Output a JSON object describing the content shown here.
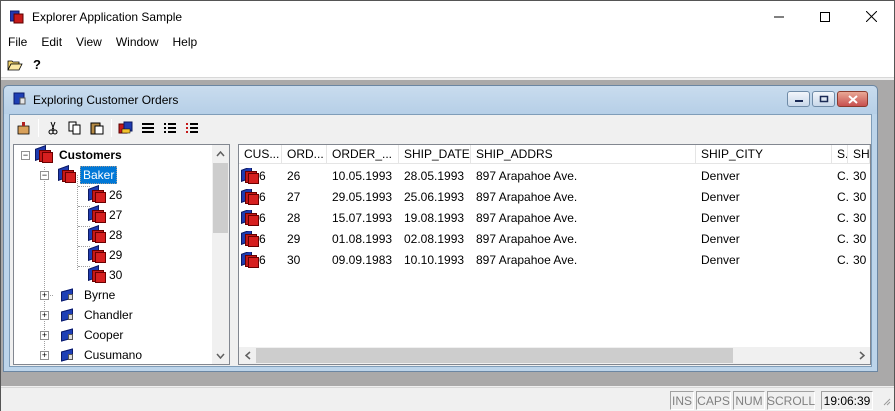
{
  "window": {
    "title": "Explorer Application Sample"
  },
  "window_controls": {
    "minimize": "—",
    "maximize": "☐",
    "close": "✕"
  },
  "menu": [
    "File",
    "Edit",
    "View",
    "Window",
    "Help"
  ],
  "toolbar": {
    "help_glyph": "?"
  },
  "child": {
    "title": "Exploring Customer Orders"
  },
  "tree": {
    "root": "Customers",
    "expanded": "Baker",
    "orders": [
      "26",
      "27",
      "28",
      "29",
      "30"
    ],
    "collapsed": [
      "Byrne",
      "Chandler",
      "Cooper",
      "Cusumano"
    ]
  },
  "list": {
    "columns": [
      "CUS...",
      "ORD...",
      "ORDER_...",
      "SHIP_DATE",
      "SHIP_ADDRS",
      "SHIP_CITY",
      "S...",
      "SH"
    ],
    "rows": [
      [
        "6",
        "26",
        "10.05.1993",
        "28.05.1993",
        "897 Arapahoe Ave.",
        "Denver",
        "C...",
        "30"
      ],
      [
        "6",
        "27",
        "29.05.1993",
        "25.06.1993",
        "897 Arapahoe Ave.",
        "Denver",
        "C...",
        "30"
      ],
      [
        "6",
        "28",
        "15.07.1993",
        "19.08.1993",
        "897 Arapahoe Ave.",
        "Denver",
        "C...",
        "30"
      ],
      [
        "6",
        "29",
        "01.08.1993",
        "02.08.1993",
        "897 Arapahoe Ave.",
        "Denver",
        "C...",
        "30"
      ],
      [
        "6",
        "30",
        "09.09.1983",
        "10.10.1993",
        "897 Arapahoe Ave.",
        "Denver",
        "C...",
        "30"
      ]
    ]
  },
  "status": {
    "ins": "INS",
    "caps": "CAPS",
    "num": "NUM",
    "scroll": "SCROLL",
    "time": "19:06:39"
  }
}
